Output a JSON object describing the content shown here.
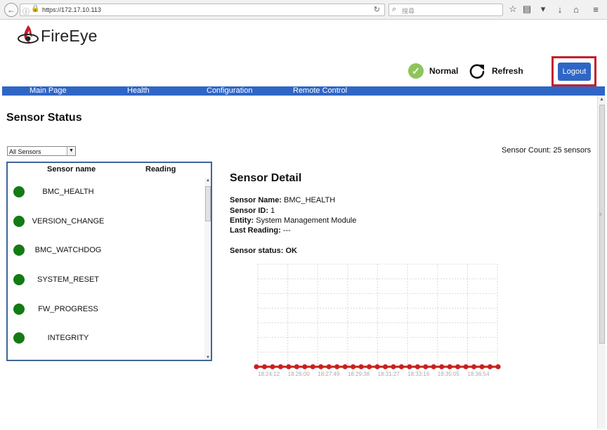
{
  "browser": {
    "url": "https://172.17.10.113",
    "search_placeholder": "搜尋"
  },
  "header": {
    "logo_text": "FireEye",
    "status_label": "Normal",
    "refresh_label": "Refresh",
    "logout_label": "Logout",
    "accent_color": "#2f66c6",
    "highlight_color": "#c3202b"
  },
  "nav": {
    "items": [
      {
        "label": "Main Page"
      },
      {
        "label": "Health"
      },
      {
        "label": "Configuration"
      },
      {
        "label": "Remote Control"
      }
    ]
  },
  "main": {
    "title": "Sensor Status",
    "filter_selected": "All Sensors",
    "sensor_count": "Sensor Count: 25 sensors"
  },
  "sensor_list": {
    "col_name": "Sensor name",
    "col_reading": "Reading",
    "status_color": "#147a14",
    "items": [
      {
        "name": "BMC_HEALTH"
      },
      {
        "name": "VERSION_CHANGE"
      },
      {
        "name": "BMC_WATCHDOG"
      },
      {
        "name": "SYSTEM_RESET"
      },
      {
        "name": "FW_PROGRESS"
      },
      {
        "name": "INTEGRITY"
      }
    ]
  },
  "detail": {
    "title": "Sensor Detail",
    "name_label": "Sensor Name:",
    "name_value": "BMC_HEALTH",
    "id_label": "Sensor ID:",
    "id_value": "1",
    "entity_label": "Entity:",
    "entity_value": "System Management Module",
    "reading_label": "Last Reading:",
    "reading_value": "---",
    "status_label": "Sensor status:",
    "status_value": "OK"
  },
  "chart_data": {
    "type": "line",
    "x_tick_labels": [
      "18:24:12",
      "18:26:00",
      "18:27:49",
      "18:29:38",
      "18:31:27",
      "18:33:16",
      "18:35:05",
      "18:36:54"
    ],
    "points": 31,
    "values": [
      0,
      0,
      0,
      0,
      0,
      0,
      0,
      0,
      0,
      0,
      0,
      0,
      0,
      0,
      0,
      0,
      0,
      0,
      0,
      0,
      0,
      0,
      0,
      0,
      0,
      0,
      0,
      0,
      0,
      0,
      0
    ],
    "grid": true,
    "series_color": "#cc1f1f"
  }
}
